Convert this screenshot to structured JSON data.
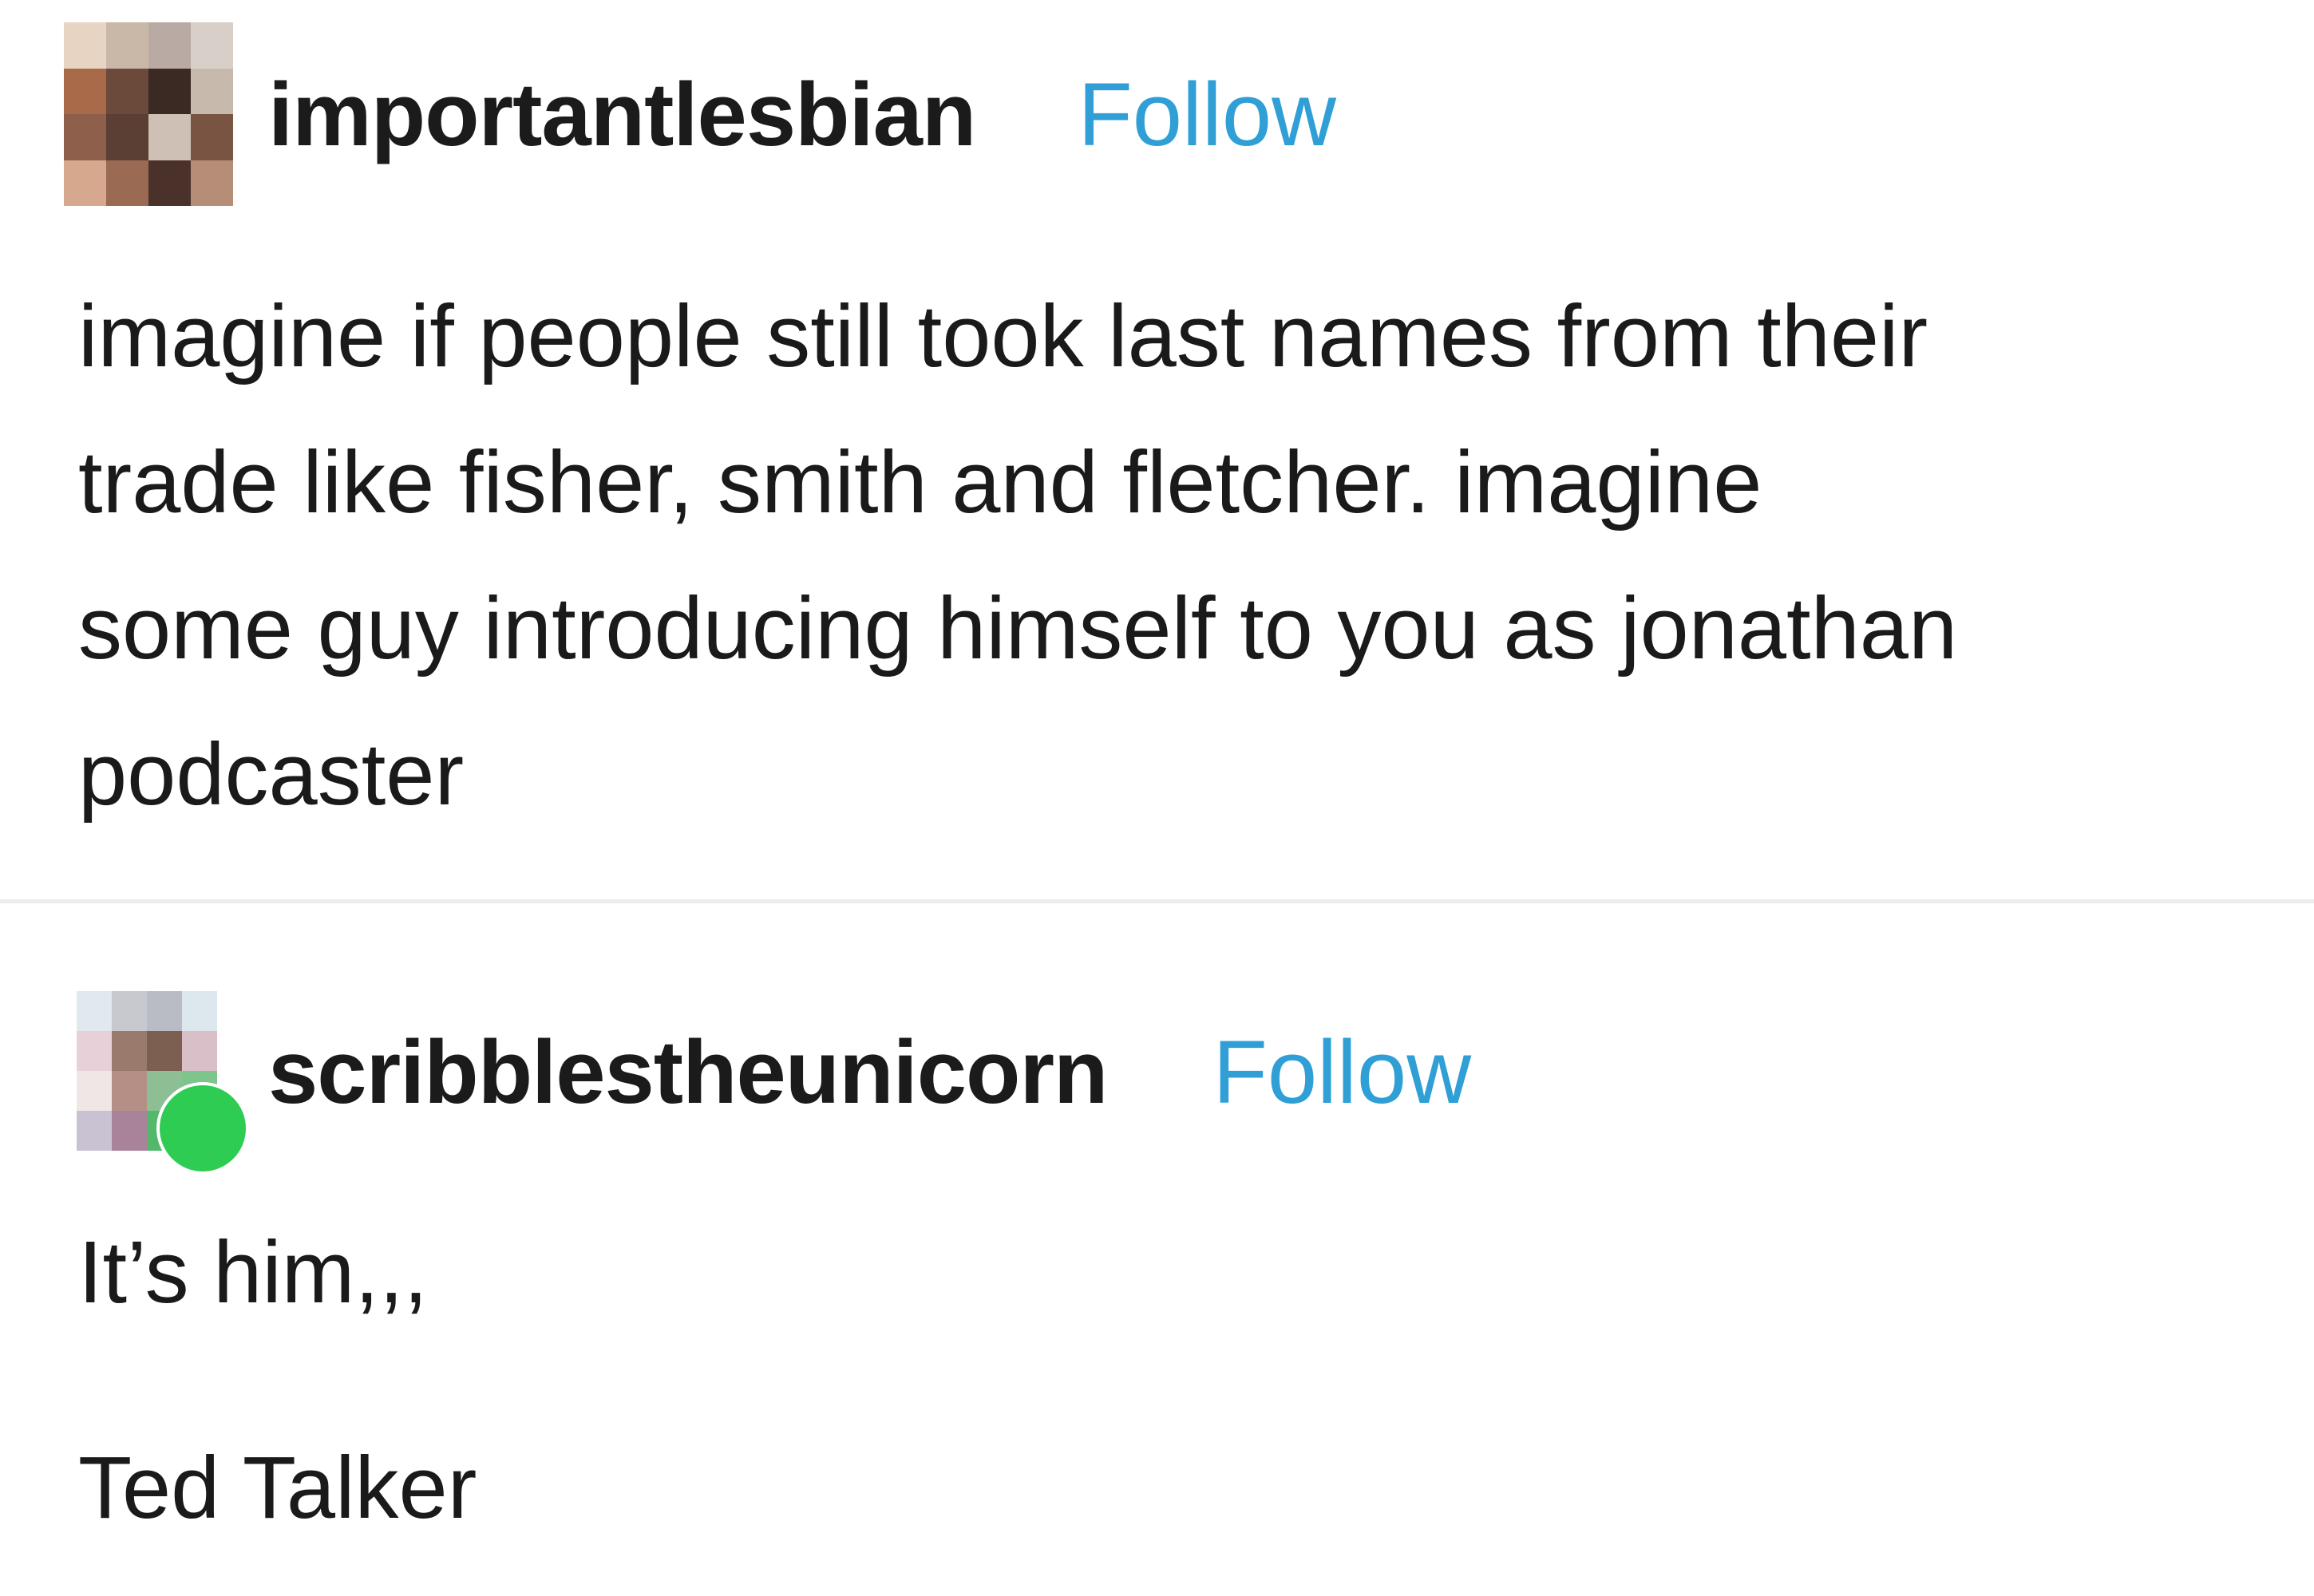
{
  "posts": [
    {
      "username": "importantlesbian",
      "follow_label": "Follow",
      "body_lines": [
        "imagine if people still took last names from their",
        "trade like fisher, smith and fletcher. imagine",
        "some guy introducing himself to you as jonathan",
        "podcaster"
      ]
    },
    {
      "username": "scribblestheunicorn",
      "follow_label": "Follow",
      "paragraphs": [
        "It’s him,,,",
        "Ted Talker"
      ]
    }
  ],
  "colors": {
    "follow": "#2f9fd6",
    "text": "#1a1a1a",
    "online_indicator": "#2ecc52",
    "divider": "#ececec"
  },
  "icons": {
    "avatar_1": "pixelated-avatar-icon",
    "avatar_2": "pixelated-avatar-icon",
    "online_indicator": "online-status-dot-icon"
  }
}
